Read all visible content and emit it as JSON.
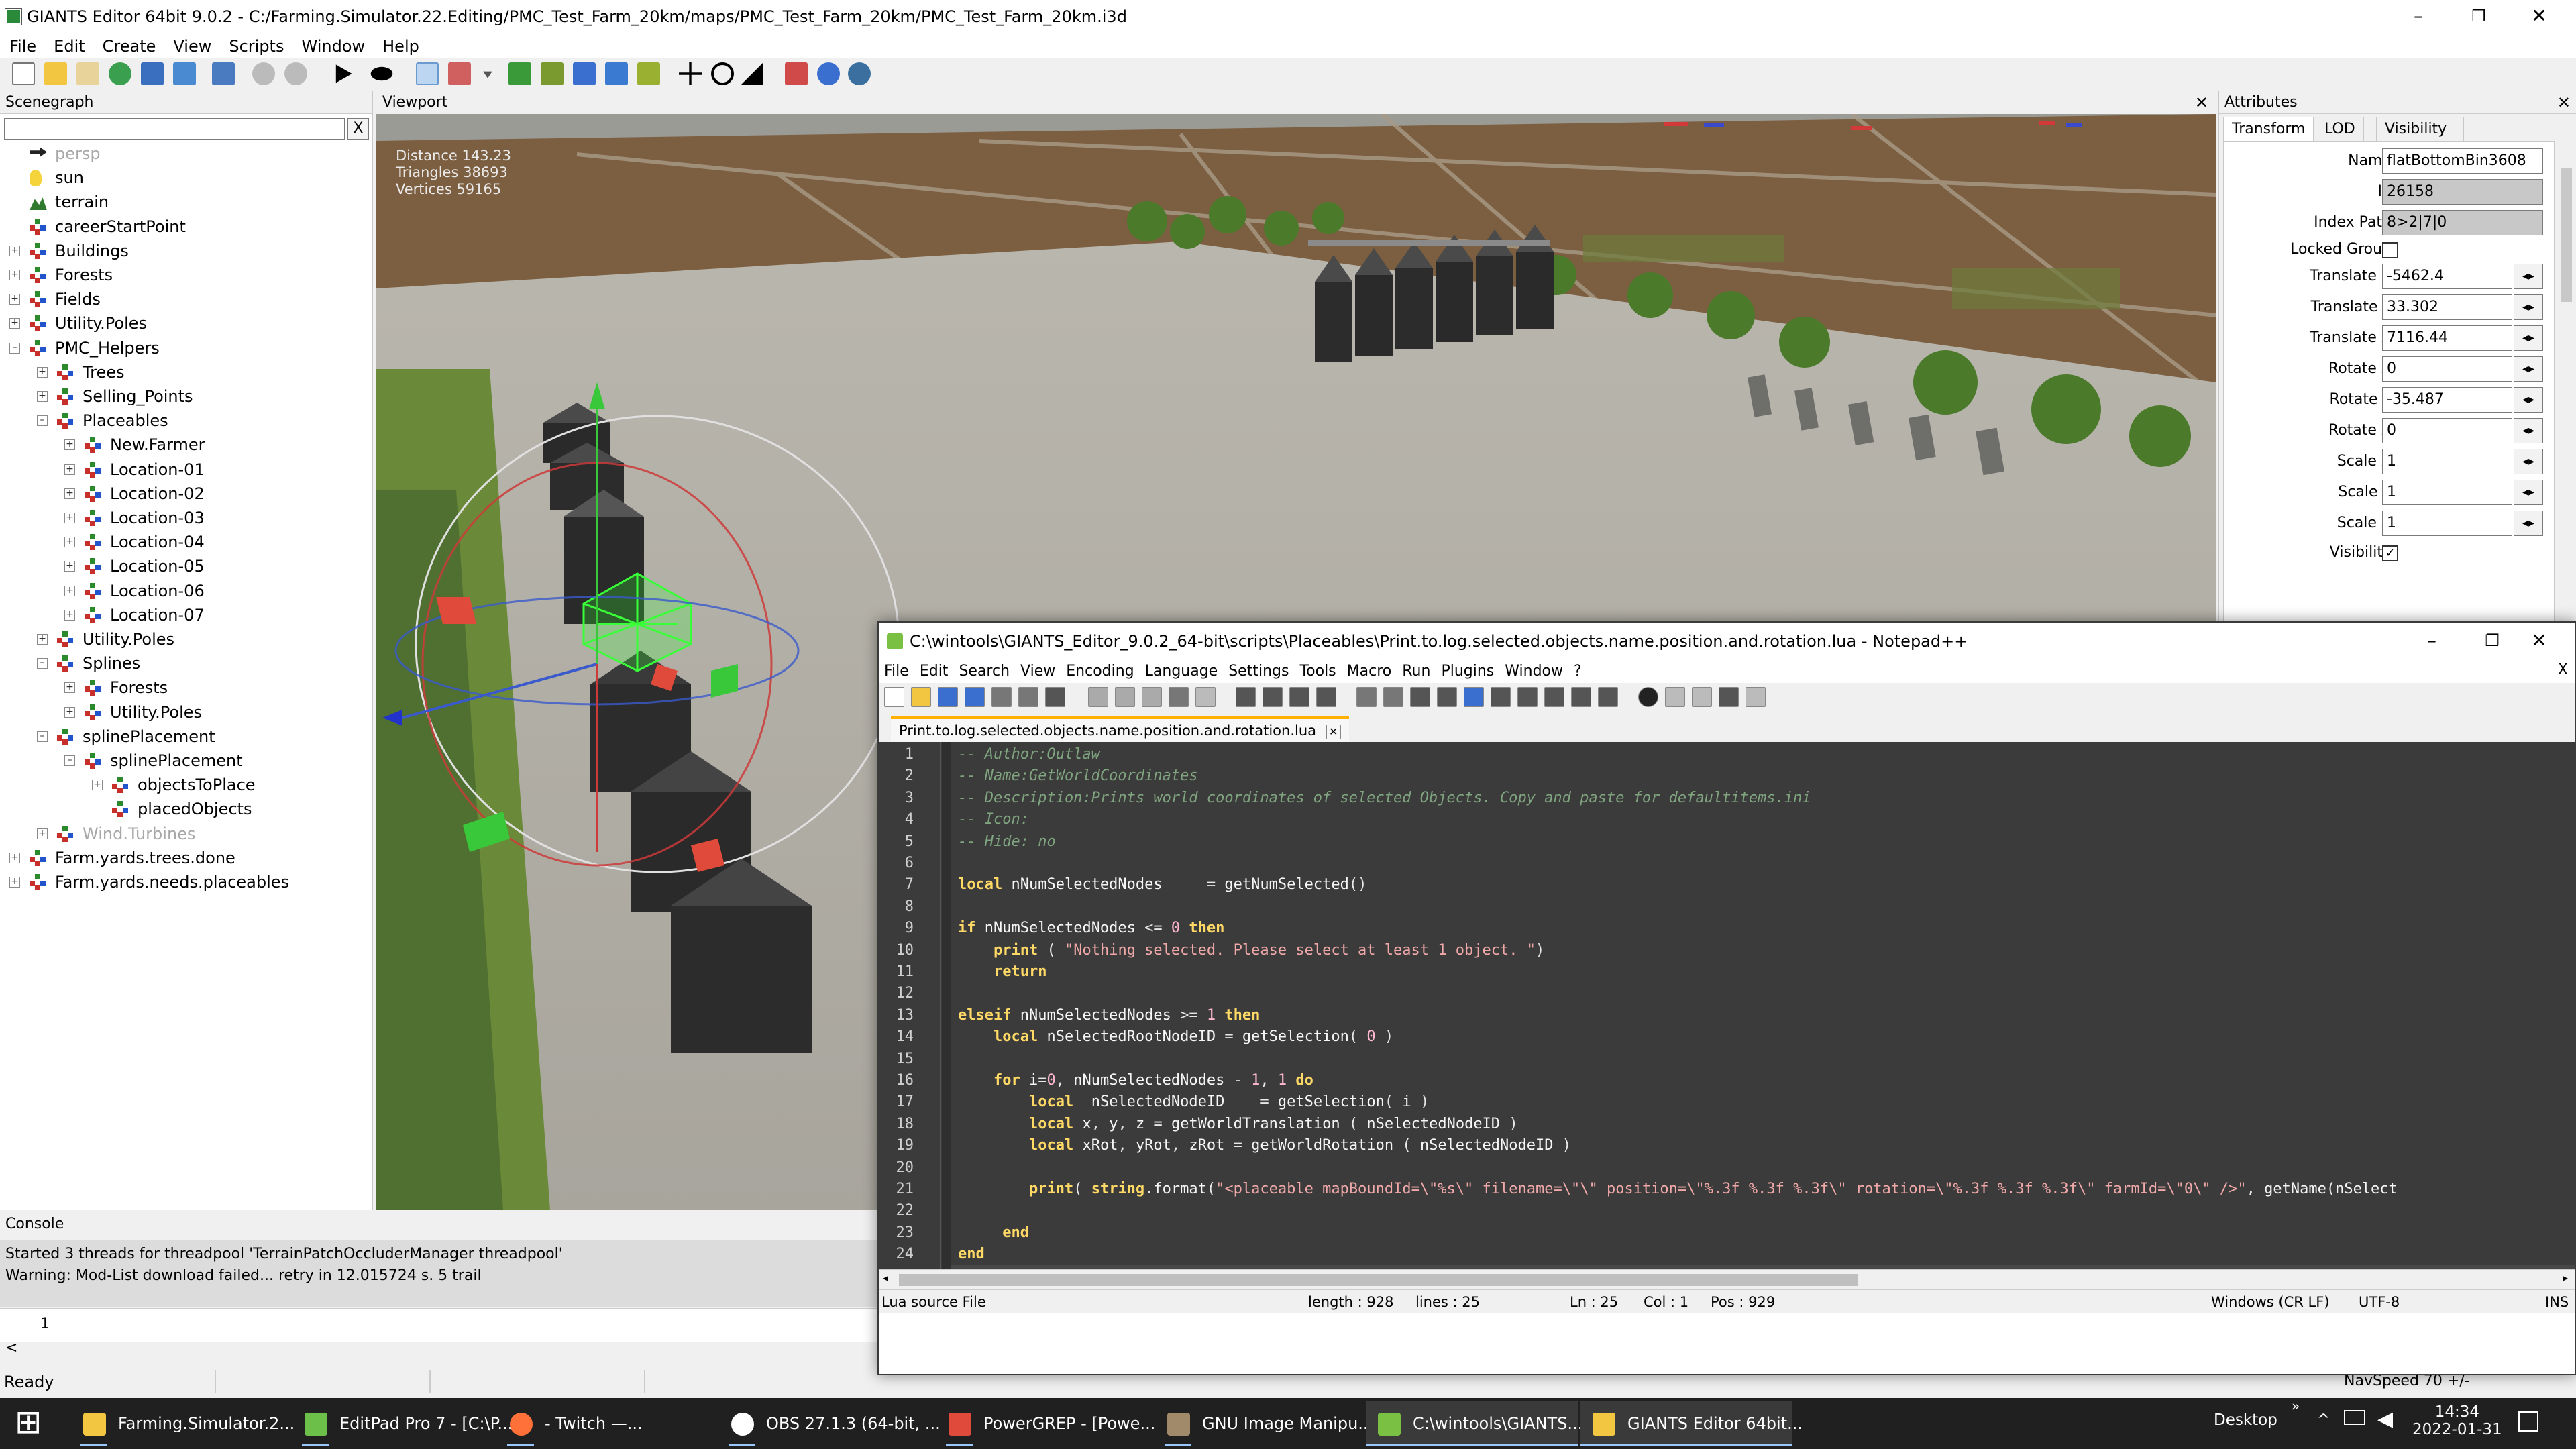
{
  "window": {
    "title": "GIANTS Editor 64bit 9.0.2 - C:/Farming.Simulator.22.Editing/PMC_Test_Farm_20km/maps/PMC_Test_Farm_20km/PMC_Test_Farm_20km.i3d",
    "minimize": "–",
    "maximize": "❐",
    "close": "✕"
  },
  "menu": [
    "File",
    "Edit",
    "Create",
    "View",
    "Scripts",
    "Window",
    "Help"
  ],
  "scenegraph": {
    "title": "Scenegraph",
    "search_placeholder": "",
    "clear": "X",
    "items": [
      {
        "label": "persp",
        "depth": 0,
        "exp": "",
        "icon": "camera-icon",
        "faded": true
      },
      {
        "label": "sun",
        "depth": 0,
        "exp": "",
        "icon": "light-bulb-icon"
      },
      {
        "label": "terrain",
        "depth": 0,
        "exp": "",
        "icon": "terrain-icon"
      },
      {
        "label": "careerStartPoint",
        "depth": 0,
        "exp": "",
        "icon": "transform-group-icon"
      },
      {
        "label": "Buildings",
        "depth": 0,
        "exp": "+",
        "icon": "transform-group-icon"
      },
      {
        "label": "Forests",
        "depth": 0,
        "exp": "+",
        "icon": "transform-group-icon"
      },
      {
        "label": "Fields",
        "depth": 0,
        "exp": "+",
        "icon": "transform-group-icon"
      },
      {
        "label": "Utility.Poles",
        "depth": 0,
        "exp": "+",
        "icon": "transform-group-icon"
      },
      {
        "label": "PMC_Helpers",
        "depth": 0,
        "exp": "–",
        "icon": "transform-group-icon"
      },
      {
        "label": "Trees",
        "depth": 1,
        "exp": "+",
        "icon": "transform-group-icon"
      },
      {
        "label": "Selling_Points",
        "depth": 1,
        "exp": "+",
        "icon": "transform-group-icon"
      },
      {
        "label": "Placeables",
        "depth": 1,
        "exp": "–",
        "icon": "transform-group-icon"
      },
      {
        "label": "New.Farmer",
        "depth": 2,
        "exp": "+",
        "icon": "transform-group-icon"
      },
      {
        "label": "Location-01",
        "depth": 2,
        "exp": "+",
        "icon": "transform-group-icon"
      },
      {
        "label": "Location-02",
        "depth": 2,
        "exp": "+",
        "icon": "transform-group-icon"
      },
      {
        "label": "Location-03",
        "depth": 2,
        "exp": "+",
        "icon": "transform-group-icon"
      },
      {
        "label": "Location-04",
        "depth": 2,
        "exp": "+",
        "icon": "transform-group-icon"
      },
      {
        "label": "Location-05",
        "depth": 2,
        "exp": "+",
        "icon": "transform-group-icon"
      },
      {
        "label": "Location-06",
        "depth": 2,
        "exp": "+",
        "icon": "transform-group-icon"
      },
      {
        "label": "Location-07",
        "depth": 2,
        "exp": "+",
        "icon": "transform-group-icon"
      },
      {
        "label": "Utility.Poles",
        "depth": 1,
        "exp": "+",
        "icon": "transform-group-icon"
      },
      {
        "label": "Splines",
        "depth": 1,
        "exp": "–",
        "icon": "transform-group-icon"
      },
      {
        "label": "Forests",
        "depth": 2,
        "exp": "+",
        "icon": "transform-group-icon"
      },
      {
        "label": "Utility.Poles",
        "depth": 2,
        "exp": "+",
        "icon": "transform-group-icon"
      },
      {
        "label": "splinePlacement",
        "depth": 1,
        "exp": "–",
        "icon": "transform-group-icon"
      },
      {
        "label": "splinePlacement",
        "depth": 2,
        "exp": "–",
        "icon": "transform-group-icon"
      },
      {
        "label": "objectsToPlace",
        "depth": 3,
        "exp": "+",
        "icon": "transform-group-icon"
      },
      {
        "label": "placedObjects",
        "depth": 3,
        "exp": "",
        "icon": "transform-group-icon"
      },
      {
        "label": "Wind.Turbines",
        "depth": 1,
        "exp": "+",
        "icon": "transform-group-icon",
        "faded": true
      },
      {
        "label": "Farm.yards.trees.done",
        "depth": 0,
        "exp": "+",
        "icon": "transform-group-icon"
      },
      {
        "label": "Farm.yards.needs.placeables",
        "depth": 0,
        "exp": "+",
        "icon": "transform-group-icon"
      }
    ]
  },
  "viewport": {
    "title": "Viewport",
    "close": "✕",
    "stats": [
      "Distance 143.23",
      "Triangles 38693",
      "Vertices 59165"
    ],
    "camera": "persp"
  },
  "attributes": {
    "title": "Attributes",
    "close": "✕",
    "tabs": [
      "Transform",
      "LOD",
      "Visibility Condition"
    ],
    "fields": [
      {
        "label": "Name",
        "value": "flatBottomBin3608",
        "type": "wide"
      },
      {
        "label": "Id",
        "value": "26158",
        "type": "ro"
      },
      {
        "label": "Index Path",
        "value": "8>2|7|0",
        "type": "ro"
      },
      {
        "label": "Locked Group",
        "value": "",
        "type": "check"
      },
      {
        "label": "Translate X",
        "value": "-5462.4",
        "type": "spin"
      },
      {
        "label": "Translate Y",
        "value": "33.302",
        "type": "spin"
      },
      {
        "label": "Translate Z",
        "value": "7116.44",
        "type": "spin"
      },
      {
        "label": "Rotate X",
        "value": "0",
        "type": "spin"
      },
      {
        "label": "Rotate Y",
        "value": "-35.487",
        "type": "spin"
      },
      {
        "label": "Rotate Z",
        "value": "0",
        "type": "spin"
      },
      {
        "label": "Scale X",
        "value": "1",
        "type": "spin"
      },
      {
        "label": "Scale Y",
        "value": "1",
        "type": "spin"
      },
      {
        "label": "Scale Z",
        "value": "1",
        "type": "spin"
      },
      {
        "label": "Visibility",
        "value": "✓",
        "type": "check"
      }
    ],
    "spin_glyph": "◂▸"
  },
  "console": {
    "title": "Console",
    "lines": [
      "Started 3 threads for threadpool 'TerrainPatchOccluderManager threadpool'",
      "Warning: Mod-List download failed... retry in 12.015724 s. 5 trail"
    ],
    "input_line": "1",
    "hscroll": "<"
  },
  "status": {
    "ready": "Ready",
    "navspeed": "NavSpeed 70 +/-"
  },
  "notepad": {
    "title": "C:\\wintools\\GIANTS_Editor_9.0.2_64-bit\\scripts\\Placeables\\Print.to.log.selected.objects.name.position.and.rotation.lua - Notepad++",
    "menu": [
      "File",
      "Edit",
      "Search",
      "View",
      "Encoding",
      "Language",
      "Settings",
      "Tools",
      "Macro",
      "Run",
      "Plugins",
      "Window",
      "?"
    ],
    "menu_close": "X",
    "tab": "Print.to.log.selected.objects.name.position.and.rotation.lua",
    "tab_close": "✕",
    "lines": [
      "-- Author:Outlaw",
      "-- Name:GetWorldCoordinates",
      "-- Description:Prints world coordinates of selected Objects. Copy and paste for defaultitems.ini",
      "-- Icon:",
      "-- Hide: no",
      "",
      "local nNumSelectedNodes     = getNumSelected()",
      "",
      "if nNumSelectedNodes <= 0 then",
      "    print ( \"Nothing selected. Please select at least 1 object. \")",
      "    return",
      "",
      "elseif nNumSelectedNodes >= 1 then",
      "    local nSelectedRootNodeID = getSelection( 0 )",
      "",
      "    for i=0, nNumSelectedNodes - 1, 1 do",
      "        local  nSelectedNodeID    = getSelection( i )",
      "        local x, y, z = getWorldTranslation ( nSelectedNodeID )",
      "        local xRot, yRot, zRot = getWorldRotation ( nSelectedNodeID )",
      "",
      "        print( string.format(\"<placeable mapBoundId=\\\"%s\\\" filename=\\\"\\\" position=\\\"%.3f %.3f %.3f\\\" rotation=\\\"%.3f %.3f %.3f\\\" farmId=\\\"0\\\" />\", getName(nSelect",
      "",
      "     end",
      "end",
      ""
    ],
    "status": {
      "filetype": "Lua source File",
      "length": "length : 928",
      "lines": "lines : 25",
      "ln": "Ln : 25",
      "col": "Col : 1",
      "pos": "Pos : 929",
      "eol": "Windows (CR LF)",
      "enc": "UTF-8",
      "ins": "INS"
    }
  },
  "taskbar": {
    "start": "⊞",
    "items": [
      {
        "label": "Farming.Simulator.2...",
        "icon": "folder-icon",
        "color": "#f2c641"
      },
      {
        "label": "EditPad Pro 7 - [C:\\P...",
        "icon": "editpad-icon",
        "color": "#6cc04a"
      },
      {
        "label": "            - Twitch —...",
        "icon": "firefox-icon",
        "color": "#ff7139"
      },
      {
        "label": "OBS 27.1.3 (64-bit, ...",
        "icon": "obs-icon",
        "color": "#ffffff"
      },
      {
        "label": "PowerGREP - [Powe...",
        "icon": "powergrep-icon",
        "color": "#e04a3a"
      },
      {
        "label": "GNU Image Manipu...",
        "icon": "gimp-icon",
        "color": "#a08a6a"
      },
      {
        "label": "C:\\wintools\\GIANTS...",
        "icon": "notepadpp-icon",
        "color": "#7ac043",
        "active": true
      },
      {
        "label": "GIANTS Editor 64bit...",
        "icon": "giants-icon",
        "color": "#f2c641",
        "active": true
      }
    ],
    "desktop": "Desktop",
    "time": "14:34",
    "date": "2022-01-31",
    "chevron": "»"
  }
}
